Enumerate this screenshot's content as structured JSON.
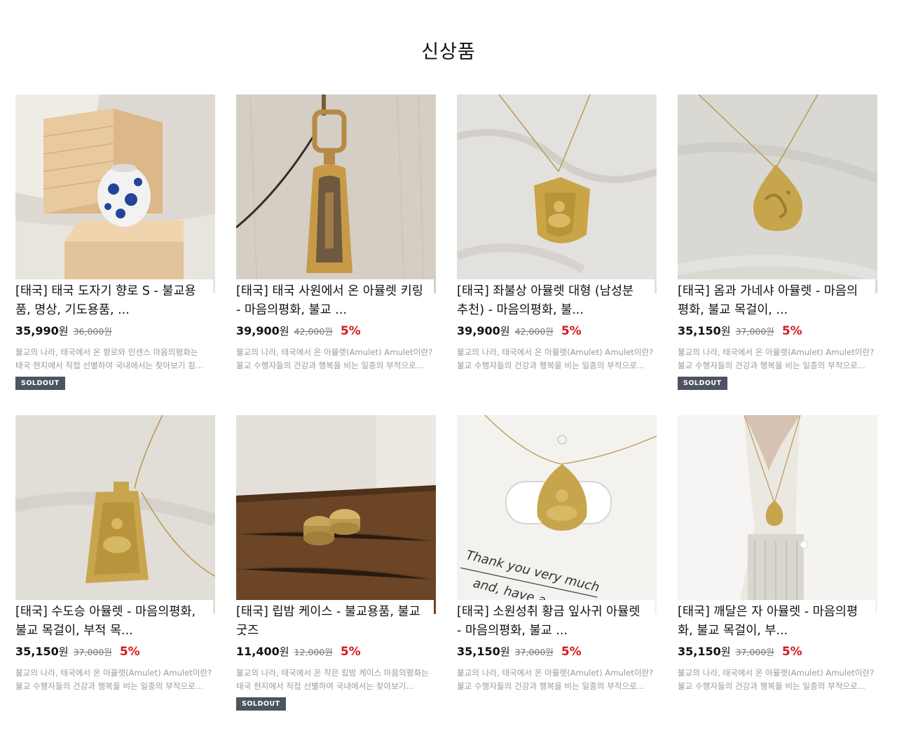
{
  "section": {
    "title": "신상품"
  },
  "colors": {
    "discount": "#d41a1a",
    "badge": "#4e5363",
    "description": "#9a9a9a"
  },
  "products": [
    {
      "name": "[태국] 태국 도자기 향로 S - 불교용품, 명상, 기도용품, ...",
      "price": "35,990",
      "won": "원",
      "original": "36,000원",
      "discount": "",
      "desc": "불교의 나라, 태국에서 온 향로와 인센스 마음의평화는 태국 현지에서 직접 선별하여 국내에서는 찾아보기 힘...",
      "badge": "SOLDOUT",
      "image": "ceramic-incense-burner-photo"
    },
    {
      "name": "[태국] 태국 사원에서 온 아뮬렛 키링 - 마음의평화, 불교 ...",
      "price": "39,900",
      "won": "원",
      "original": "42,000원",
      "discount": "5%",
      "desc": "불교의 나라, 태국에서 온 아뮬렛(Amulet) Amulet이란? 불교 수행자들의 건강과 행복을 비는 일종의 부적으로...",
      "badge": "",
      "image": "amulet-keyring-photo"
    },
    {
      "name": "[태국] 좌불상 아뮬렛 대형 (남성분 추천) - 마음의평화, 불...",
      "price": "39,900",
      "won": "원",
      "original": "42,000원",
      "discount": "5%",
      "desc": "불교의 나라, 태국에서 온 아뮬렛(Amulet) Amulet이란? 불교 수행자들의 건강과 행복을 비는 일종의 부적으로...",
      "badge": "",
      "image": "seated-buddha-amulet-photo"
    },
    {
      "name": "[태국] 옴과 가네샤 아뮬렛 - 마음의평화, 불교 목걸이, ...",
      "price": "35,150",
      "won": "원",
      "original": "37,000원",
      "discount": "5%",
      "desc": "불교의 나라, 태국에서 온 아뮬렛(Amulet) Amulet이란? 불교 수행자들의 건강과 행복을 비는 일종의 부적으로...",
      "badge": "SOLDOUT",
      "image": "om-ganesha-amulet-photo"
    },
    {
      "name": "[태국] 수도승 아뮬렛 - 마음의평화, 불교 목걸이, 부적 목...",
      "price": "35,150",
      "won": "원",
      "original": "37,000원",
      "discount": "5%",
      "desc": "불교의 나라, 태국에서 온 아뮬렛(Amulet) Amulet이란? 불교 수행자들의 건강과 행복을 비는 일종의 부적으로...",
      "badge": "",
      "image": "monk-amulet-photo"
    },
    {
      "name": "[태국] 립밤 케이스 - 불교용품, 불교굿즈",
      "price": "11,400",
      "won": "원",
      "original": "12,000원",
      "discount": "5%",
      "desc": "불교의 나라, 태국에서 온 작은 립밤 케이스 마음의평화는 태국 현지에서 직접 선별하여 국내에서는 찾아보기...",
      "badge": "SOLDOUT",
      "image": "lip-balm-case-photo"
    },
    {
      "name": "[태국] 소원성취 황금 잎사귀 아뮬렛 - 마음의평화, 불교 ...",
      "price": "35,150",
      "won": "원",
      "original": "37,000원",
      "discount": "5%",
      "desc": "불교의 나라, 태국에서 온 아뮬렛(Amulet) Amulet이란? 불교 수행자들의 건강과 행복을 비는 일종의 부적으로...",
      "badge": "",
      "image": "golden-leaf-amulet-photo",
      "card_text": [
        "Thank you very much",
        "and, have a"
      ]
    },
    {
      "name": "[태국] 깨달은 자 아뮬렛 - 마음의평화, 불교 목걸이, 부...",
      "price": "35,150",
      "won": "원",
      "original": "37,000원",
      "discount": "5%",
      "desc": "불교의 나라, 태국에서 온 아뮬렛(Amulet) Amulet이란? 불교 수행자들의 건강과 행복을 비는 일종의 부적으로...",
      "badge": "",
      "image": "enlightened-one-amulet-photo"
    }
  ]
}
